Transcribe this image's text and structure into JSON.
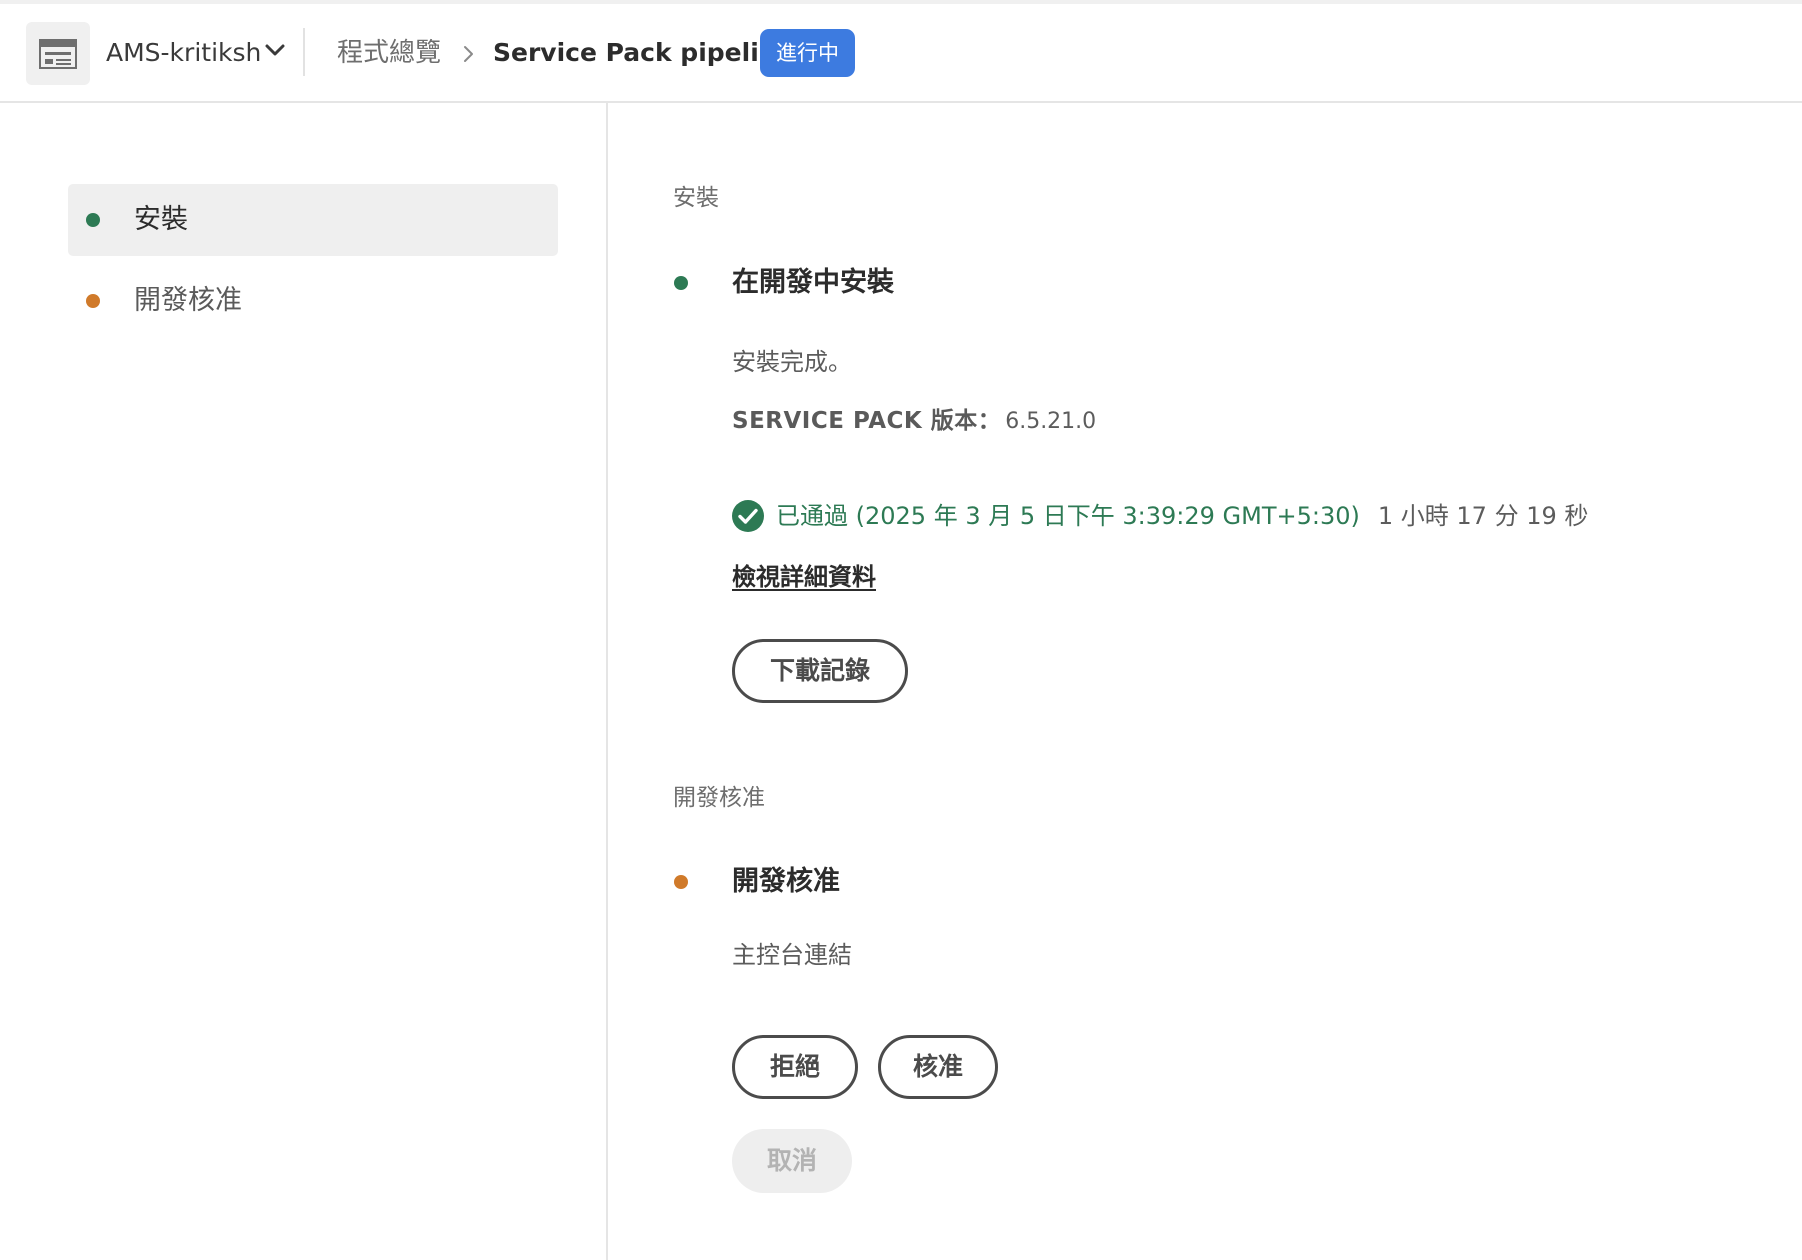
{
  "header": {
    "program_name": "AMS-kritiksh",
    "breadcrumb_overview": "程式總覽",
    "breadcrumb_current": "Service Pack pipeline",
    "status_badge": "進行中",
    "badge_color": "#3d7be0"
  },
  "sidebar": {
    "items": [
      {
        "label": "安裝",
        "status_color": "#2d7a54",
        "active": true
      },
      {
        "label": "開發核准",
        "status_color": "#d07a2a",
        "active": false
      }
    ]
  },
  "install_section": {
    "section_label": "安裝",
    "step_title": "在開發中安裝",
    "message": "安裝完成。",
    "version_label": "SERVICE PACK 版本：",
    "version_value": "6.5.21.0",
    "passed_text": "已通過 (2025 年 3 月 5 日下午 3:39:29  GMT+5:30)",
    "duration": "1 小時 17 分 19 秒",
    "details_link": "檢視詳細資料",
    "download_button": "下載記錄"
  },
  "approval_section": {
    "section_label": "開發核准",
    "step_title": "開發核准",
    "message": "主控台連結",
    "reject_button": "拒絕",
    "approve_button": "核准",
    "cancel_button": "取消"
  },
  "colors": {
    "success_green": "#2d7a54",
    "pending_orange": "#d07a2a"
  },
  "icons": {
    "app_icon": "layout-icon",
    "dropdown": "chevron-down-icon",
    "breadcrumb_separator": "chevron-right-icon",
    "passed": "checkmark-circle-icon"
  }
}
